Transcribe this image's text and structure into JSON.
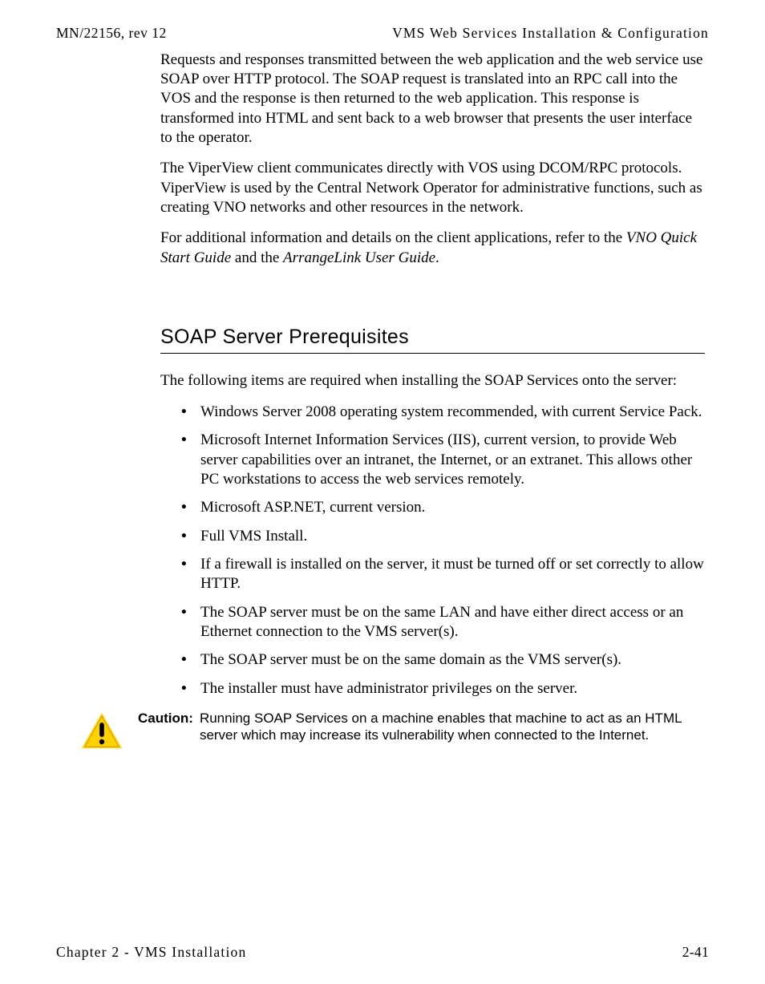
{
  "header": {
    "left": "MN/22156, rev 12",
    "right": "VMS Web Services Installation & Configuration"
  },
  "paragraphs": {
    "p1": "Requests and responses transmitted between the web application and the web service use SOAP over HTTP protocol. The SOAP request is translated into an RPC call into the VOS and the response is then returned to the web application. This response is transformed into HTML and sent back to a web browser that presents the user interface to the operator.",
    "p2": "The ViperView client communicates directly with VOS using DCOM/RPC protocols. ViperView is used by the Central Network Operator for administrative functions, such as creating VNO networks and other resources in the network.",
    "p3_pre": "For additional information and details on the client applications, refer to the ",
    "p3_em1": "VNO Quick Start Guide",
    "p3_mid": " and the ",
    "p3_em2": "ArrangeLink User Guide",
    "p3_post": "."
  },
  "section": {
    "heading": "SOAP Server Prerequisites",
    "intro": "The following items are required when installing the SOAP Services onto the server:",
    "bullets": [
      "Windows Server 2008 operating system recommended, with current Service Pack.",
      "Microsoft Internet Information Services (IIS), current version, to provide Web server capabilities over an intranet, the Internet, or an extranet. This allows other PC workstations to access the web services remotely.",
      "Microsoft ASP.NET, current version.",
      "Full VMS Install.",
      "If a firewall is installed on the server, it must be turned off or set correctly to allow HTTP.",
      "The SOAP server must be on the same LAN and have either direct access or an Ethernet connection to the VMS server(s).",
      "The SOAP server must be on the same domain as the VMS server(s).",
      "The installer must have administrator privileges on the server."
    ]
  },
  "caution": {
    "label": "Caution:",
    "body": "Running SOAP Services on a machine enables that machine to act as an HTML server which may increase its vulnerability when connected to the Internet."
  },
  "footer": {
    "left": "Chapter 2 - VMS Installation",
    "right": "2-41"
  }
}
